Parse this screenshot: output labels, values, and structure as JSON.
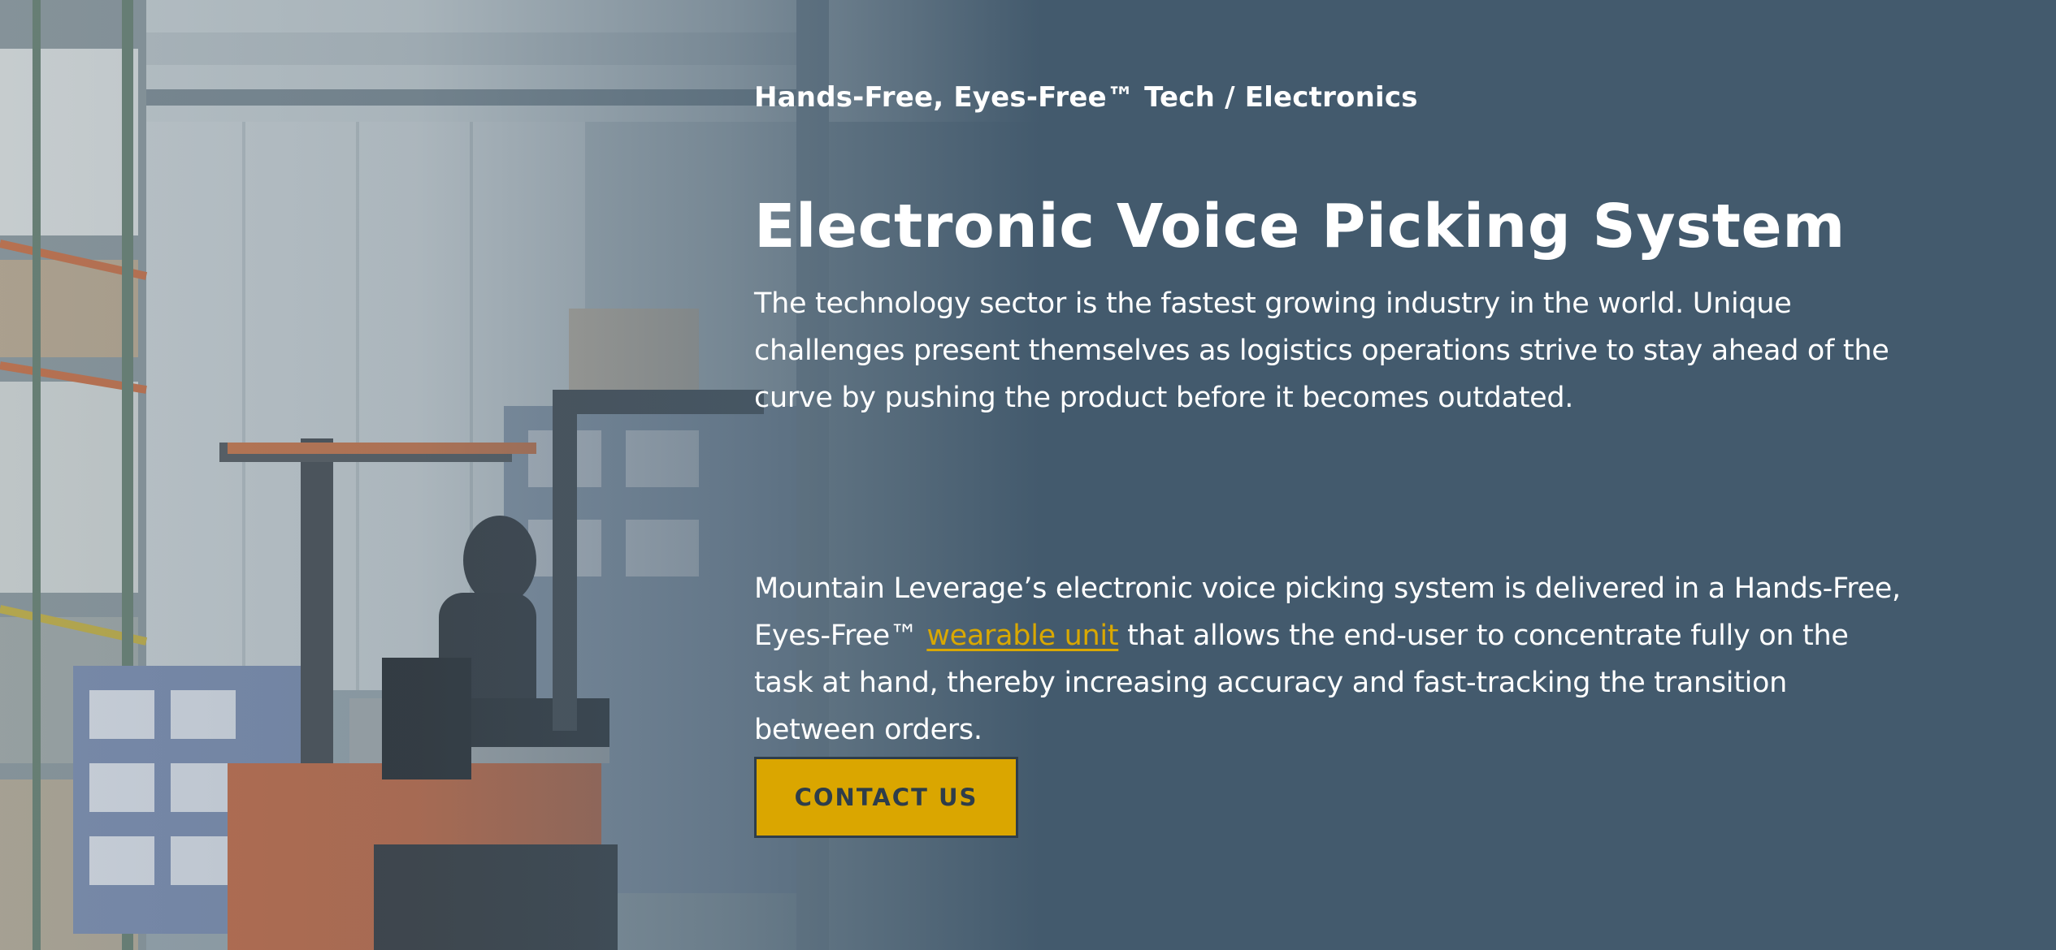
{
  "hero": {
    "eyebrow": "Hands-Free, Eyes-Free™ Tech / Electronics",
    "title": "Electronic Voice Picking System",
    "paragraph1": "The technology sector is the fastest growing industry in the world. Unique challenges present themselves as logistics operations strive to stay ahead of the curve by pushing the product before it becomes outdated.",
    "paragraph2": {
      "before_link": "Mountain Leverage’s electronic voice picking system is delivered in a Hands-Free, Eyes-Free™ ",
      "link_text": "wearable unit",
      "after_link": " that allows the end-user to concentrate fully on the task at hand, thereby increasing accuracy and fast-tracking the transition between orders."
    },
    "cta_label": "CONTACT US"
  },
  "colors": {
    "background": "#435a6d",
    "accent": "#daa600",
    "link": "#d9a800",
    "text": "#ffffff",
    "button_text": "#2e3d4a"
  },
  "icons": {
    "background_image": "warehouse-forklift-photo"
  }
}
